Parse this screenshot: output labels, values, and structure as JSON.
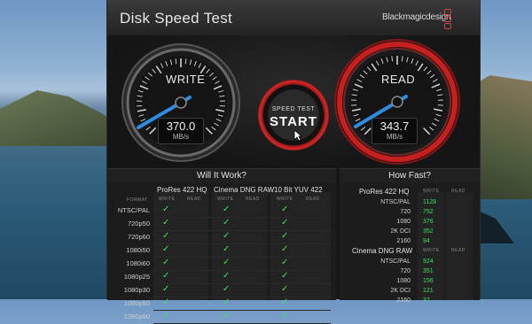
{
  "window": {
    "title": "Disk Speed Test",
    "brand": "Blackmagicdesign"
  },
  "write_gauge": {
    "label": "WRITE",
    "value": "370.0",
    "unit": "MB/s"
  },
  "read_gauge": {
    "label": "READ",
    "value": "343.7",
    "unit": "MB/s"
  },
  "start_button": {
    "line1": "SPEED TEST",
    "line2": "START"
  },
  "will_it_work": {
    "title": "Will It Work?",
    "format_label": "FORMAT",
    "write_label": "WRITE",
    "read_label": "READ",
    "columns": [
      "ProRes 422 HQ",
      "Cinema DNG RAW",
      "10 Bit YUV 422"
    ],
    "rows": [
      "NTSC/PAL",
      "720p50",
      "720p60",
      "1080i50",
      "1080i60",
      "1080p25",
      "1080p30",
      "1080p50",
      "1080p60"
    ],
    "check_glyph": "✓"
  },
  "how_fast": {
    "title": "How Fast?",
    "write_label": "WRITE",
    "read_label": "READ",
    "groups": [
      {
        "name": "ProRes 422 HQ",
        "rows": [
          {
            "label": "NTSC/PAL",
            "write": "1128"
          },
          {
            "label": "720",
            "write": "752"
          },
          {
            "label": "1080",
            "write": "376"
          },
          {
            "label": "2K DCI",
            "write": "352"
          },
          {
            "label": "2160",
            "write": "94"
          }
        ]
      },
      {
        "name": "Cinema DNG RAW",
        "rows": [
          {
            "label": "NTSC/PAL",
            "write": "924"
          },
          {
            "label": "720",
            "write": "351"
          },
          {
            "label": "1080",
            "write": "156"
          },
          {
            "label": "2K DCI",
            "write": "121"
          },
          {
            "label": "2160",
            "write": "37"
          }
        ]
      }
    ]
  },
  "colors": {
    "accent_green": "#3fe05a",
    "needle_blue": "#2f8de0",
    "ring_red": "#c42020"
  }
}
